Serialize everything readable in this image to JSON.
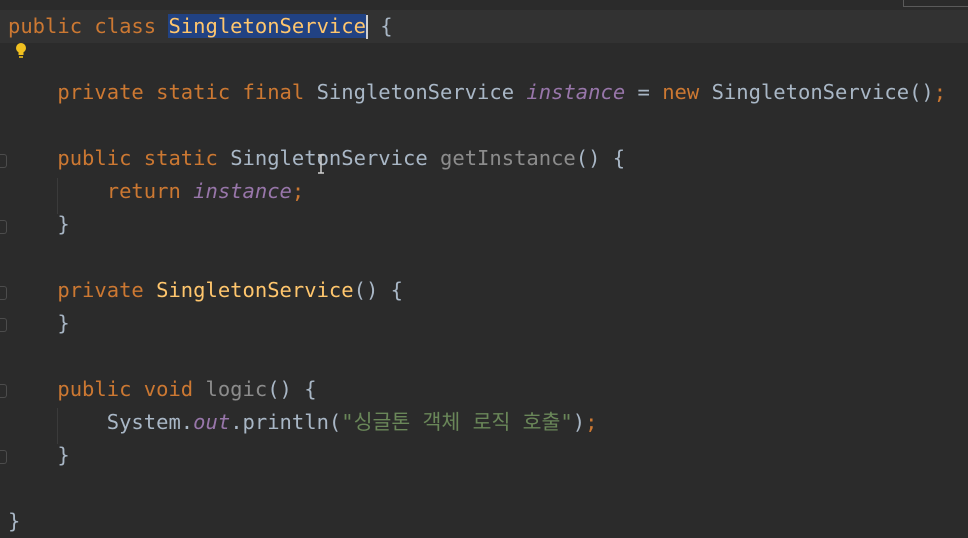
{
  "code": {
    "class_decl": {
      "public": "public",
      "class": "class",
      "name": "SingletonService",
      "open": "{"
    },
    "field": {
      "private": "private",
      "static": "static",
      "final": "final",
      "type": "SingletonService",
      "name": "instance",
      "assign": "=",
      "new": "new",
      "ctor": "SingletonService",
      "paren": "()",
      "semi": ";"
    },
    "get_instance": {
      "public": "public",
      "static": "static",
      "type": "SingletonService",
      "name": "getInstance",
      "sig": "() {",
      "return": "return",
      "ret_val": "instance",
      "semi": ";",
      "close": "}"
    },
    "ctor": {
      "private": "private",
      "name": "SingletonService",
      "sig": "() {",
      "close": "}"
    },
    "logic": {
      "public": "public",
      "void": "void",
      "name": "logic",
      "sig": "() {",
      "system": "System.",
      "out": "out",
      "println": ".println(",
      "string": "\"싱글톤 객체 로직 호출\"",
      "end": ")",
      "semi": ";",
      "close": "}"
    },
    "class_close": "}"
  },
  "colors": {
    "background": "#2b2b2b",
    "keyword": "#cc7832",
    "plain": "#a9b7c6",
    "declaration": "#ffc66d",
    "field": "#9876aa",
    "string": "#6a8759",
    "selection": "#214283",
    "intention_bulb": "#f0c020"
  },
  "icons": [
    "intention-bulb-icon",
    "fold-marker-icon",
    "text-cursor-icon"
  ]
}
